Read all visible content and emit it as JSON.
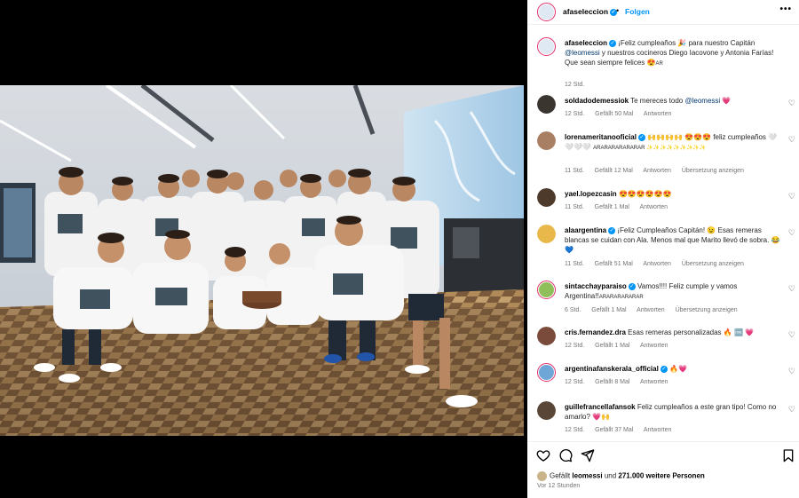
{
  "post": {
    "username": "afaseleccion",
    "follow_label": "Folgen",
    "separator": "•",
    "more_label": "•••"
  },
  "caption": {
    "username": "afaseleccion",
    "text_before": "¡Feliz cumpleaños 🎉 para nuestro Capitán ",
    "mention": "@leomessi",
    "text_after": " y nuestros cocineros Diego Iacovone y Antonia Farías! Que sean siempre felices 😍",
    "flag": "AR",
    "time": "12 Std."
  },
  "comments": [
    {
      "username": "soldadodemessiok",
      "verified": false,
      "text_before": "Te mereces todo ",
      "mention": "@leomessi",
      "text_after": " 💗",
      "flags": "",
      "time": "12 Std.",
      "likes": "Gefällt 50 Mal",
      "reply": "Antworten",
      "translate": ""
    },
    {
      "username": "lorenameritanooficial",
      "verified": true,
      "text_before": "🙌🙌🙌🙌 😍😍😍 feliz cumpleaños 🤍🤍🤍🤍",
      "mention": "",
      "text_after": "",
      "flags": "ARARARARARARAR ✨✨✨✨✨✨✨✨✨",
      "time": "11 Std.",
      "likes": "Gefällt 12 Mal",
      "reply": "Antworten",
      "translate": "Übersetzung anzeigen"
    },
    {
      "username": "yael.lopezcasin",
      "verified": false,
      "text_before": "😍😍😍😍😍😍",
      "mention": "",
      "text_after": "",
      "flags": "",
      "time": "11 Std.",
      "likes": "Gefällt 1 Mal",
      "reply": "Antworten",
      "translate": ""
    },
    {
      "username": "alaargentina",
      "verified": true,
      "text_before": "¡Feliz Cumpleaños Capitán! 😉 Esas remeras blancas se cuidan con Ala. Menos mal que Marito llevó de sobra. 😂💙",
      "mention": "",
      "text_after": "",
      "flags": "",
      "time": "11 Std.",
      "likes": "Gefällt 51 Mal",
      "reply": "Antworten",
      "translate": "Übersetzung anzeigen"
    },
    {
      "username": "sintacchayparaiso",
      "verified": true,
      "text_before": "Vamos!!!! Feliz cumple y vamos Argentina!!",
      "mention": "",
      "text_after": "",
      "flags": "ARARARARARAR",
      "time": "6 Std.",
      "likes": "Gefällt 1 Mal",
      "reply": "Antworten",
      "translate": "Übersetzung anzeigen"
    },
    {
      "username": "cris.fernandez.dra",
      "verified": false,
      "text_before": "Esas remeras personalizadas 🔥 🆒 💗",
      "mention": "",
      "text_after": "",
      "flags": "",
      "time": "12 Std.",
      "likes": "Gefällt 1 Mal",
      "reply": "Antworten",
      "translate": ""
    },
    {
      "username": "argentinafanskerala_official",
      "verified": true,
      "text_before": "🔥💗",
      "mention": "",
      "text_after": "",
      "flags": "",
      "time": "12 Std.",
      "likes": "Gefällt 8 Mal",
      "reply": "Antworten",
      "translate": ""
    },
    {
      "username": "guillefrancellafansok",
      "verified": false,
      "text_before": "Feliz cumpleaños a este gran tipo! Como no amarlo? 💗🙌",
      "mention": "",
      "text_after": "",
      "flags": "",
      "time": "12 Std.",
      "likes": "Gefällt 37 Mal",
      "reply": "Antworten",
      "translate": ""
    }
  ],
  "footer": {
    "likes_prefix": "Gefällt ",
    "likes_user": "leomessi",
    "likes_middle": " und ",
    "likes_count": "271.000 weitere Personen",
    "time_ago": "Vor 12 Stunden"
  },
  "icons": {
    "heart": "heart-icon",
    "comment": "comment-icon",
    "share": "share-icon",
    "save": "bookmark-icon",
    "more": "more-icon"
  },
  "colors": {
    "link": "#0095f6",
    "mention": "#00376b",
    "meta": "#737373",
    "ring": "#e1306c"
  }
}
